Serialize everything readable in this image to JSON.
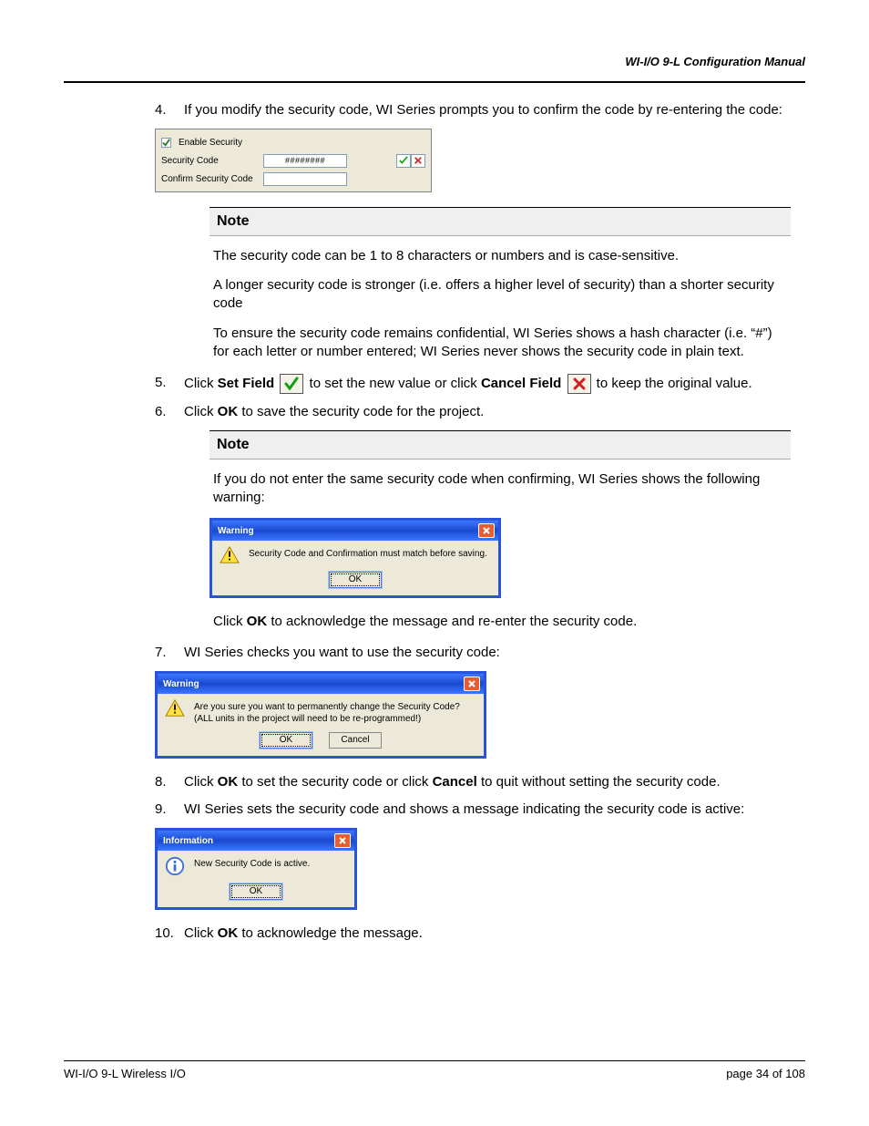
{
  "header": {
    "title": "WI-I/O 9-L Configuration Manual"
  },
  "steps": {
    "s4": {
      "num": "4.",
      "text": "If you modify the security code, WI Series prompts you to confirm the code by re-entering the code:"
    },
    "s5": {
      "num": "5.",
      "pre": "Click ",
      "b1": "Set Field",
      "mid": " to set the new value or click ",
      "b2": "Cancel Field",
      "post": " to keep the original value."
    },
    "s6": {
      "num": "6.",
      "pre": "Click ",
      "b1": "OK",
      "post": " to save the security code for the project."
    },
    "s7": {
      "num": "7.",
      "text": "WI Series checks you want to use the security code:"
    },
    "s8": {
      "num": "8.",
      "pre": "Click ",
      "b1": "OK",
      "mid": " to set the security code or click ",
      "b2": "Cancel",
      "post": " to quit without setting the security code."
    },
    "s9": {
      "num": "9.",
      "text": "WI Series sets the security code and shows a message indicating the security code is active:"
    },
    "s10": {
      "num": "10.",
      "pre": "Click ",
      "b1": "OK",
      "post": " to acknowledge the message."
    }
  },
  "note1": {
    "heading": "Note",
    "p1": "The security code can be 1 to 8 characters or numbers and is case-sensitive.",
    "p2": "A longer security code is stronger (i.e. offers a higher level of security) than a shorter security code",
    "p3": "To ensure the security code remains confidential, WI Series shows a hash character (i.e. “#”) for each letter or number entered; WI Series never shows the security code in plain text."
  },
  "note2": {
    "heading": "Note",
    "p1": "If you do not enter the same security code when confirming, WI Series shows the following warning:",
    "p2pre": "Click ",
    "p2b": "OK",
    "p2post": " to acknowledge the message and re-enter the security code."
  },
  "sec_panel": {
    "enable": "Enable Security",
    "label_code": "Security Code",
    "label_confirm": "Confirm Security Code",
    "value": "########"
  },
  "warn1": {
    "title": "Warning",
    "msg": "Security Code and Confirmation must match before saving.",
    "ok": "OK"
  },
  "warn2": {
    "title": "Warning",
    "msg1": "Are you sure you want to permanently change the Security Code?",
    "msg2": "(ALL units in the project will need to be re-programmed!)",
    "ok": "OK",
    "cancel": "Cancel"
  },
  "info1": {
    "title": "Information",
    "msg": "New Security Code is active.",
    "ok": "OK"
  },
  "footer": {
    "left": "WI-I/O 9-L Wireless I/O",
    "right_pre": "page ",
    "page_current": "34",
    "right_mid": " of ",
    "page_total": "108"
  }
}
